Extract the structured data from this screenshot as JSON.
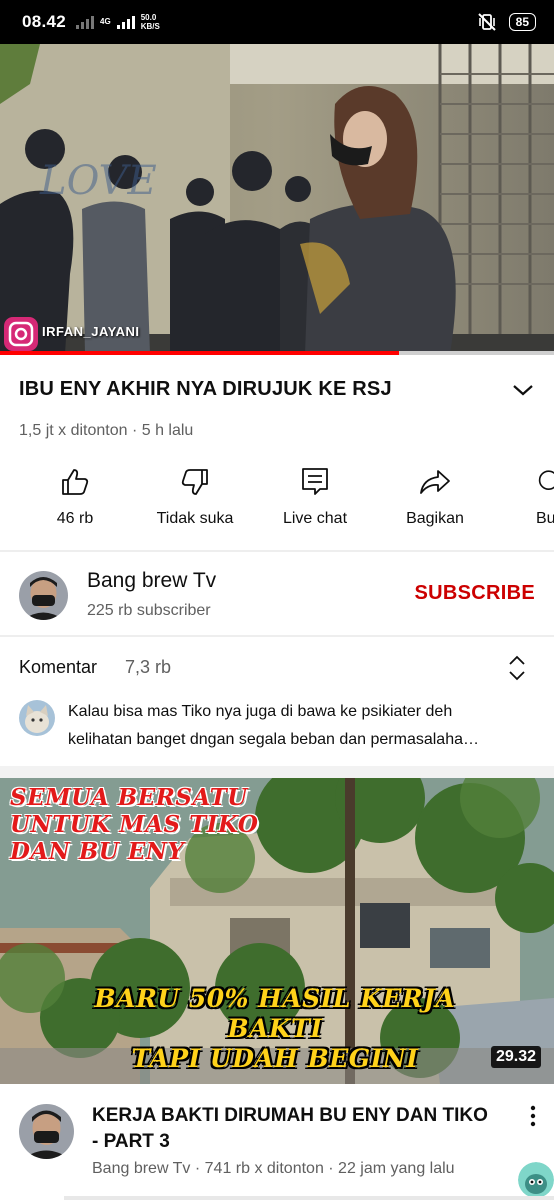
{
  "status_bar": {
    "time": "08.42",
    "network_type": "4G",
    "speed_value": "50.0",
    "speed_unit": "KB/S",
    "battery": "85",
    "icons": [
      "x-signal-icon",
      "signal-icon",
      "mute-vibrate-icon",
      "battery-icon"
    ]
  },
  "player": {
    "watermark": "IRFAN_JAYANI",
    "progress": 0.72,
    "accent_color": "#ff0000"
  },
  "video": {
    "title": "IBU ENY AKHIR NYA DIRUJUK KE RSJ",
    "meta": "1,5 jt x ditonton · 5 h lalu"
  },
  "actions": [
    {
      "icon": "thumbs-up-icon",
      "label": "46 rb"
    },
    {
      "icon": "thumbs-down-icon",
      "label": "Tidak suka"
    },
    {
      "icon": "live-chat-icon",
      "label": "Live chat"
    },
    {
      "icon": "share-icon",
      "label": "Bagikan"
    },
    {
      "icon": "partial-icon",
      "label": "Bu"
    }
  ],
  "channel": {
    "name": "Bang brew Tv",
    "subscribers": "225 rb subscriber",
    "subscribe_label": "SUBSCRIBE",
    "subscribe_color": "#cc0000"
  },
  "comments": {
    "header": "Komentar",
    "count": "7,3 rb",
    "first_comment_line1": "Kalau bisa mas Tiko nya juga di bawa ke psikiater deh",
    "first_comment_line2": "kelihatan banget dngan segala beban dan permasalaha…"
  },
  "next_video": {
    "overlay_top": [
      "SEMUA BERSATU",
      "UNTUK MAS TIKO",
      "DAN BU ENY"
    ],
    "overlay_bottom": [
      "BARU 50% HASIL KERJA",
      "BAKTI",
      "TAPI UDAH BEGINI"
    ],
    "duration": "29.32",
    "title": "KERJA BAKTI DIRUMAH BU ENY DAN TIKO - PART 3",
    "meta": "Bang brew Tv · 741 rb x ditonton · 22 jam yang lalu"
  }
}
